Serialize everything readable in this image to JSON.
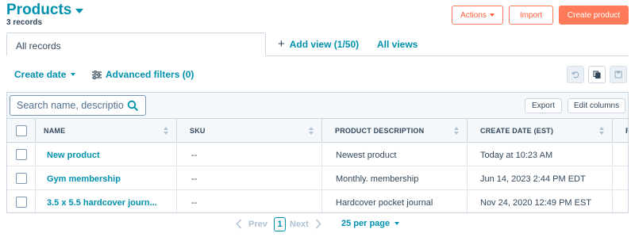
{
  "header": {
    "title": "Products",
    "record_count": "3 records",
    "actions_label": "Actions",
    "import_label": "Import",
    "create_label": "Create product"
  },
  "tabs": {
    "all_records": "All records",
    "add_view": "Add view (1/50)",
    "all_views": "All views"
  },
  "filters": {
    "create_date": "Create date",
    "advanced": "Advanced filters (0)"
  },
  "toolbar": {
    "search_placeholder": "Search name, descriptio",
    "export_label": "Export",
    "edit_columns_label": "Edit columns"
  },
  "table": {
    "columns": [
      "NAME",
      "SKU",
      "PRODUCT DESCRIPTION",
      "CREATE DATE (EST)",
      "P"
    ],
    "rows": [
      {
        "name": "New product",
        "sku": "--",
        "description": "Newest product",
        "create_date": "Today at 10:23 AM"
      },
      {
        "name": "Gym membership",
        "sku": "--",
        "description": "Monthly. membership",
        "create_date": "Jun 14, 2023 2:44 PM EDT"
      },
      {
        "name": "3.5 x 5.5 hardcover journ...",
        "sku": "--",
        "description": "Hardcover pocket journal",
        "create_date": "Nov 24, 2020 12:49 PM EST"
      }
    ]
  },
  "pagination": {
    "prev": "Prev",
    "current_page": "1",
    "next": "Next",
    "per_page": "25 per page"
  },
  "colors": {
    "accent": "#0091ae",
    "brand": "#ff7a59",
    "text": "#33475b",
    "border": "#cbd6e2"
  }
}
